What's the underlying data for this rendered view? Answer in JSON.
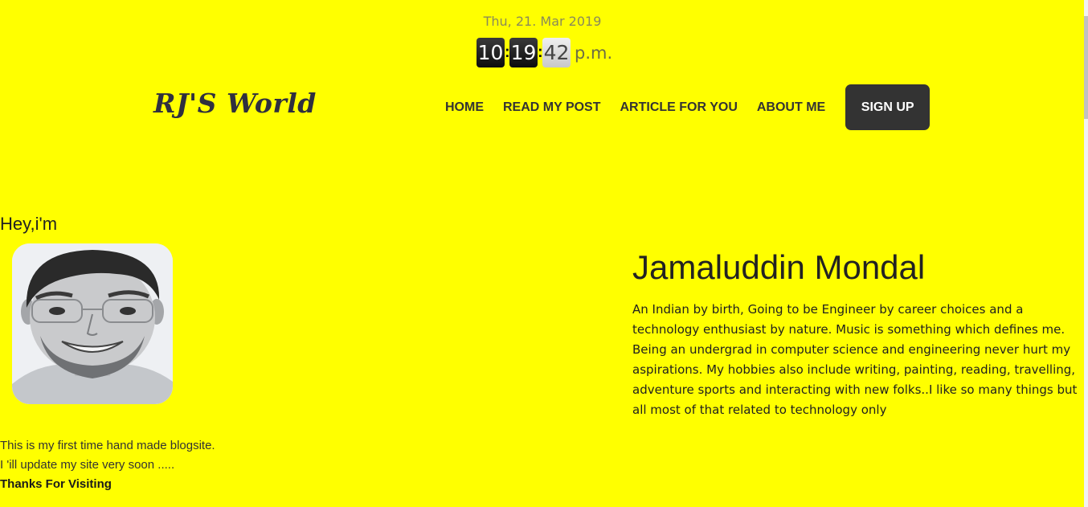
{
  "clock": {
    "date": "Thu, 21. Mar 2019",
    "hours": "10",
    "minutes": "19",
    "seconds": "42",
    "sep": ":",
    "ampm": "p.m."
  },
  "header": {
    "logo": "RJ'S World",
    "nav": [
      "HOME",
      "READ MY POST",
      "ARTICLE FOR YOU",
      "ABOUT ME"
    ],
    "signup_label": "SIGN UP"
  },
  "intro": {
    "greeting": "Hey,i'm",
    "name": "Jamaluddin Mondal",
    "bio": "An Indian by birth, Going to be Engineer by career choices and a technology enthusiast by nature. Music is something which defines me. Being an undergrad in computer science and engineering never hurt my aspirations. My hobbies also include writing, painting, reading, travelling, adventure sports and interacting with new folks..I like so many things but all most of that related to technology only",
    "note1": "This is my first time hand made blogsite.",
    "note2": "I 'ill update my site very soon .....",
    "thanks": "Thanks For Visiting"
  },
  "colors": {
    "background": "#ffff00",
    "button": "#333333",
    "text": "#2b2b2b"
  }
}
